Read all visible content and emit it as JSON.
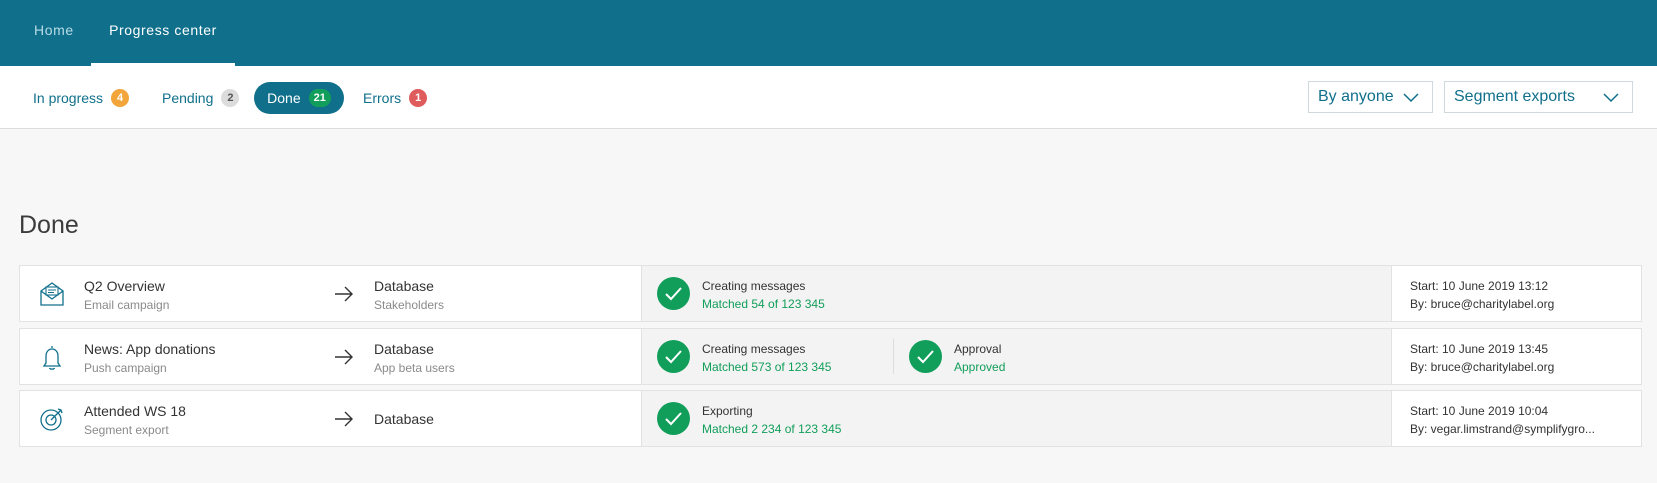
{
  "topnav": {
    "items": [
      {
        "label": "Home"
      },
      {
        "label": "Progress center"
      }
    ]
  },
  "tabs": [
    {
      "label": "In progress",
      "count": "4",
      "badge_color": "#f2a53a"
    },
    {
      "label": "Pending",
      "count": "2",
      "badge_color": "#dcdcdc"
    },
    {
      "label": "Done",
      "count": "21",
      "badge_color": "#119e5a",
      "active": true
    },
    {
      "label": "Errors",
      "count": "1",
      "badge_color": "#e05c5c"
    }
  ],
  "filters": {
    "owner": {
      "selected": "By anyone"
    },
    "type": {
      "selected": "Segment exports"
    }
  },
  "section_title": "Done",
  "rows": [
    {
      "icon": "email-icon",
      "name": "Q2 Overview",
      "kind": "Email campaign",
      "dest": "Database",
      "dest_sub": "Stakeholders",
      "steps": [
        {
          "label": "Creating messages",
          "value": "Matched 54 of 123 345",
          "status": "done"
        }
      ],
      "start": "Start: 10 June 2019 13:12",
      "by": "By: bruce@charitylabel.org"
    },
    {
      "icon": "bell-icon",
      "name": "News: App donations",
      "kind": "Push campaign",
      "dest": "Database",
      "dest_sub": "App beta users",
      "steps": [
        {
          "label": "Creating messages",
          "value": "Matched 573 of 123 345",
          "status": "done"
        },
        {
          "label": "Approval",
          "value": "Approved",
          "status": "done"
        }
      ],
      "start": "Start: 10 June 2019 13:45",
      "by": "By: bruce@charitylabel.org"
    },
    {
      "icon": "target-icon",
      "name": "Attended WS 18",
      "kind": "Segment export",
      "dest": "Database",
      "dest_sub": "",
      "steps": [
        {
          "label": "Exporting",
          "value": "Matched 2 234 of 123 345",
          "status": "done"
        }
      ],
      "start": "Start: 10 June 2019 10:04",
      "by": "By: vegar.limstrand@symplifygro..."
    }
  ],
  "colors": {
    "brand": "#10708c",
    "success": "#119e5a",
    "warning": "#f2a53a",
    "error": "#e05c5c"
  }
}
